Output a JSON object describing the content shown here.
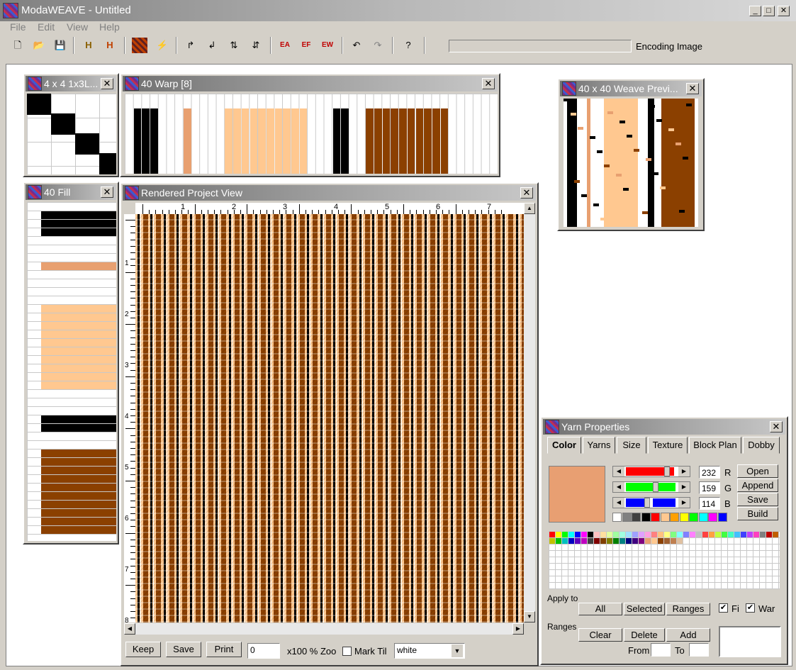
{
  "app": {
    "title": "ModaWEAVE - Untitled"
  },
  "menu": [
    "File",
    "Edit",
    "View",
    "Help"
  ],
  "status": "Encoding Image",
  "windows": {
    "pattern": {
      "title": "4 x 4 1x3L..."
    },
    "warp": {
      "title": "40 Warp  [8]"
    },
    "fill": {
      "title": "40 Fill"
    },
    "preview": {
      "title": "40 x 40 Weave Previ..."
    },
    "render": {
      "title": "Rendered Project View"
    },
    "yarn": {
      "title": "Yarn Properties"
    }
  },
  "render": {
    "ruler_x": [
      "1",
      "2",
      "3",
      "4",
      "5",
      "6",
      "7"
    ],
    "ruler_y": [
      "1",
      "2",
      "3",
      "4",
      "5",
      "6",
      "7",
      "8"
    ],
    "keep": "Keep",
    "save": "Save",
    "print": "Print",
    "zoom_value": "0",
    "zoom_label": "x100 % Zoo",
    "mark_tile": "Mark Til",
    "bg_color": "white"
  },
  "yarn": {
    "tabs": [
      "Color",
      "Yarns",
      "Size",
      "Texture",
      "Block Plan",
      "Dobby"
    ],
    "r": "232",
    "g": "159",
    "b": "114",
    "r_label": "R",
    "g_label": "G",
    "b_label": "B",
    "open": "Open",
    "append": "Append",
    "save": "Save",
    "build": "Build",
    "apply_to": "Apply to",
    "all": "All",
    "selected": "Selected",
    "ranges_btn": "Ranges",
    "fill_label": "Fi",
    "warp_label": "War",
    "ranges_label": "Ranges",
    "clear": "Clear",
    "delete": "Delete",
    "add": "Add",
    "from_label": "From",
    "to_label": "To",
    "current_color": "#E89F72"
  },
  "colors": {
    "black": "#000000",
    "salmon": "#E8A070",
    "peach": "#FFC890",
    "brown": "#8B4000"
  }
}
